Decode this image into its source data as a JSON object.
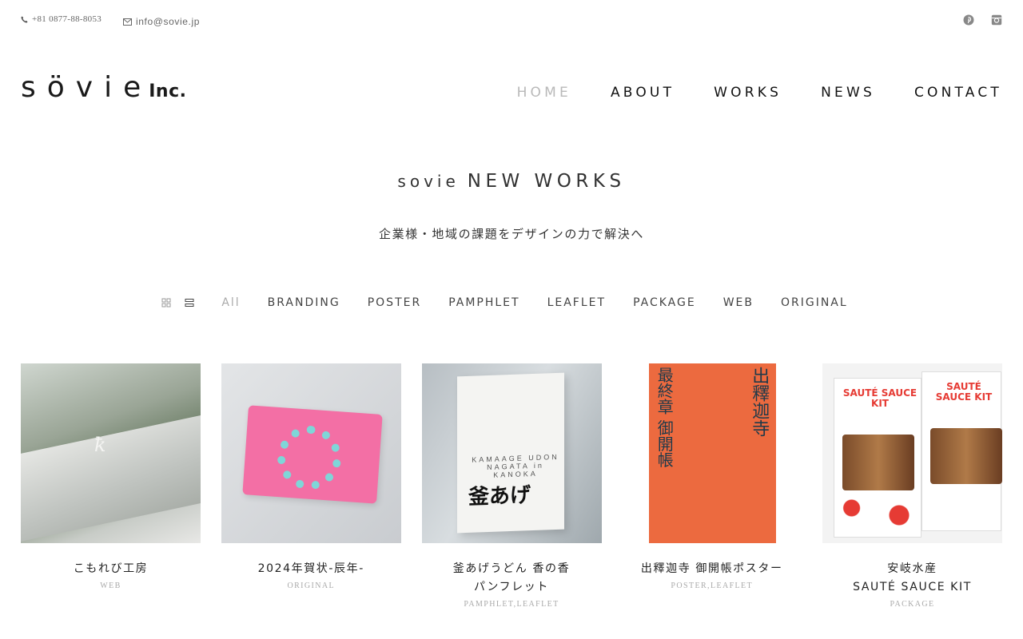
{
  "header": {
    "phone": "+81 0877-88-8053",
    "email": "info@sovie.jp",
    "social": [
      "pinterest-icon",
      "instagram-icon"
    ],
    "logo": {
      "brand": "sövie",
      "suffix": "Inc."
    },
    "nav": [
      "HOME",
      "ABOUT",
      "WORKS",
      "NEWS",
      "CONTACT"
    ],
    "active_nav": "HOME"
  },
  "section": {
    "title_small": "sovie",
    "title_large": "NEW WORKS",
    "subtitle": "企業様・地域の課題をデザインの力で解決へ"
  },
  "filters": {
    "views": [
      "grid-view-icon",
      "list-view-icon"
    ],
    "items": [
      "All",
      "BRANDING",
      "POSTER",
      "PAMPHLET",
      "LEAFLET",
      "PACKAGE",
      "WEB",
      "ORIGINAL"
    ],
    "active": "All"
  },
  "works": [
    {
      "title": "こもれび工房",
      "category": "WEB",
      "mark": "ꝁ"
    },
    {
      "title": "2024年賀状-辰年-",
      "category": "ORIGINAL"
    },
    {
      "title": "釜あげうどん 香の香 パンフレット",
      "category": "PAMPHLET,LEAFLET",
      "cover_text": "KAMAAGE UDON NAGATA in KANOKA",
      "cover_title": "釜あげ"
    },
    {
      "title": "出釋迦寺 御開帳ポスター",
      "category": "POSTER,LEAFLET",
      "poster_left": "最終章 御開帳",
      "poster_right": "出釋迦寺"
    },
    {
      "title": "安岐水産\nSAUTÉ SAUCE KIT",
      "category": "PACKAGE",
      "pkg_a": "SAUTÉ SAUCE KIT",
      "pkg_b": "SAUTÉ SAUCE KIT"
    }
  ],
  "colors": {
    "active_nav": "#b9b9b9",
    "text": "#222222",
    "category": "#aaaaaa",
    "poster": "#ec6a3f",
    "card_pink": "#f36fa5",
    "card_teal": "#7fd6d8"
  }
}
